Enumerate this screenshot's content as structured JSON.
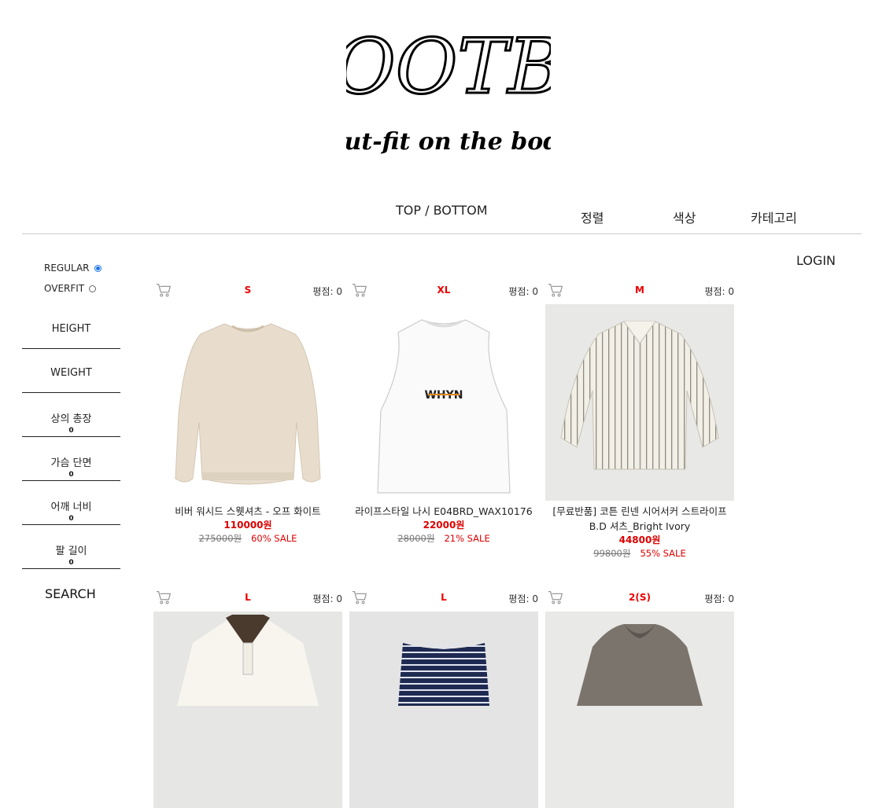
{
  "brand": {
    "logo_text": "OOTB",
    "tagline": "Out-fit on the body"
  },
  "nav": {
    "top_bottom": "TOP / BOTTOM",
    "sort": "정렬",
    "color": "색상",
    "category": "카테고리",
    "login": "LOGIN"
  },
  "sidebar": {
    "fit_options": [
      {
        "label": "REGULAR",
        "selected": true
      },
      {
        "label": "OVERFIT",
        "selected": false
      }
    ],
    "fields": [
      {
        "label": "HEIGHT",
        "value": ""
      },
      {
        "label": "WEIGHT",
        "value": ""
      },
      {
        "label": "상의 총장",
        "value": "0"
      },
      {
        "label": "가슴 단면",
        "value": "0"
      },
      {
        "label": "어깨 너비",
        "value": "0"
      },
      {
        "label": "팔 길이",
        "value": "0"
      }
    ],
    "search_label": "SEARCH"
  },
  "products": [
    {
      "size": "S",
      "rating": "평점: 0",
      "name": "비버 워시드 스웻셔츠 - 오프 화이트",
      "price": "110000원",
      "original": "275000원",
      "sale": "60% SALE",
      "icon": "sweatshirt-image"
    },
    {
      "size": "XL",
      "rating": "평점: 0",
      "name": "라이프스타일 나시 E04BRD_WAX10176",
      "price": "22000원",
      "original": "28000원",
      "sale": "21% SALE",
      "icon": "sleeveless-image",
      "print": "WHYN"
    },
    {
      "size": "M",
      "rating": "평점: 0",
      "name": "[무료반품] 코튼 린넨 시어서커 스트라이프 B.D 셔츠_Bright Ivory",
      "price": "44800원",
      "original": "99800원",
      "sale": "55% SALE",
      "icon": "striped-shirt-image"
    },
    {
      "size": "L",
      "rating": "평점: 0",
      "icon": "polo-image"
    },
    {
      "size": "L",
      "rating": "평점: 0",
      "icon": "knit-vest-image"
    },
    {
      "size": "2(S)",
      "rating": "평점: 0",
      "icon": "hoodie-image"
    }
  ],
  "colors": {
    "accent": "#e00000",
    "radio_on": "#1a73e8"
  }
}
